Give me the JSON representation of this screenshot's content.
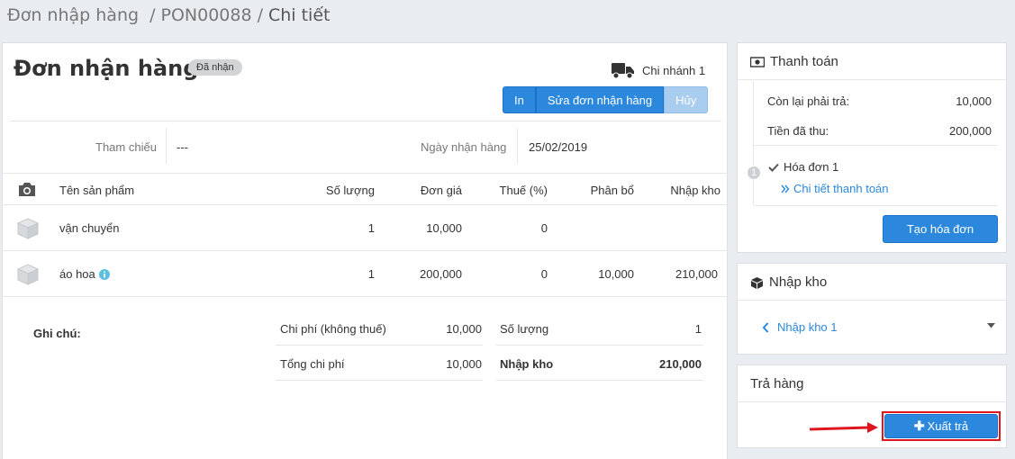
{
  "breadcrumb": {
    "part1": "Đơn nhập hàng",
    "part2": "PON00088",
    "part3": "Chi tiết",
    "sep": "/"
  },
  "order": {
    "title": "Đơn nhận hàng 1",
    "status": "Đã nhận",
    "branch": "Chi nhánh 1"
  },
  "actions": {
    "print": "In",
    "edit": "Sửa đơn nhận hàng",
    "cancel": "Hủy"
  },
  "meta": {
    "ref_label": "Tham chiếu",
    "ref_value": "---",
    "date_label": "Ngày nhận hàng",
    "date_value": "25/02/2019"
  },
  "table": {
    "headers": {
      "name": "Tên sản phẩm",
      "qty": "Số lượng",
      "price": "Đơn giá",
      "tax": "Thuế (%)",
      "alloc": "Phân bổ",
      "stock": "Nhập kho"
    },
    "rows": [
      {
        "name": "vận chuyển",
        "qty": "1",
        "price": "10,000",
        "tax": "0",
        "alloc": "",
        "stock": ""
      },
      {
        "name": "áo hoa",
        "qty": "1",
        "price": "200,000",
        "tax": "0",
        "alloc": "10,000",
        "stock": "210,000"
      }
    ]
  },
  "summary": {
    "note_label": "Ghi chú:",
    "cost_label": "Chi phí (không thuế)",
    "cost_value": "10,000",
    "total_cost_label": "Tổng chi phí",
    "total_cost_value": "10,000",
    "qty_label": "Số lượng",
    "qty_value": "1",
    "stock_label": "Nhập kho",
    "stock_value": "210,000"
  },
  "payment": {
    "title": "Thanh toán",
    "remaining_label": "Còn lại phải trả:",
    "remaining_value": "10,000",
    "paid_label": "Tiền đã thu:",
    "paid_value": "200,000",
    "step_num": "1",
    "invoice_label": "Hóa đơn 1",
    "detail_link": "Chi tiết thanh toán",
    "create_invoice": "Tạo hóa đơn"
  },
  "warehouse": {
    "title": "Nhập kho",
    "item": "Nhập kho 1"
  },
  "returns": {
    "title": "Trả hàng",
    "button": "Xuất trả"
  },
  "colors": {
    "primary": "#2b88dc",
    "highlight": "#e0161f"
  }
}
